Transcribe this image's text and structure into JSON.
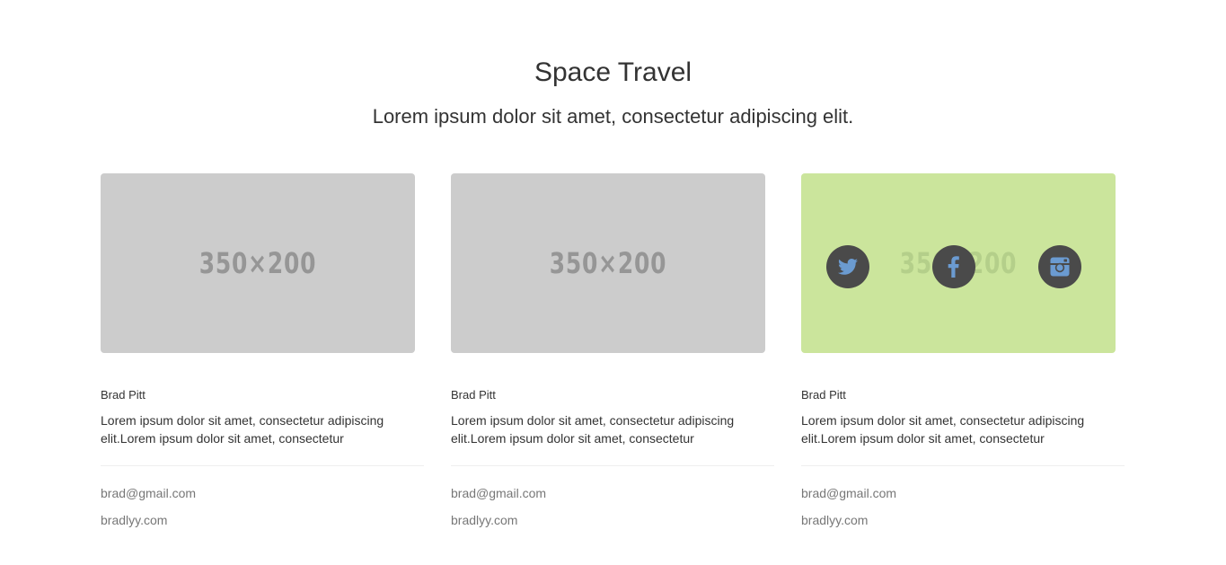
{
  "header": {
    "title": "Space Travel",
    "subtitle": "Lorem ipsum dolor sit amet, consectetur adipiscing elit."
  },
  "cards": [
    {
      "image_label": "350×200",
      "name": "Brad Pitt",
      "text": "Lorem ipsum dolor sit amet, consectetur adipiscing elit.Lorem ipsum dolor sit amet, consectetur",
      "email": "brad@gmail.com",
      "website": "bradlyy.com",
      "image_color": "#cccccc"
    },
    {
      "image_label": "350×200",
      "name": "Brad Pitt",
      "text": "Lorem ipsum dolor sit amet, consectetur adipiscing elit.Lorem ipsum dolor sit amet, consectetur",
      "email": "brad@gmail.com",
      "website": "bradlyy.com",
      "image_color": "#cccccc"
    },
    {
      "image_label": "350×200",
      "name": "Brad Pitt",
      "text": "Lorem ipsum dolor sit amet, consectetur adipiscing elit.Lorem ipsum dolor sit amet, consectetur",
      "email": "brad@gmail.com",
      "website": "bradlyy.com",
      "image_color": "#cbe59c",
      "social_icons": [
        "twitter-icon",
        "facebook-icon",
        "instagram-icon"
      ]
    }
  ],
  "colors": {
    "hover_overlay": "#cbe59c",
    "social_circle": "#4a4a4a",
    "social_glyph": "#6b9bd1",
    "muted_text": "#777777"
  }
}
